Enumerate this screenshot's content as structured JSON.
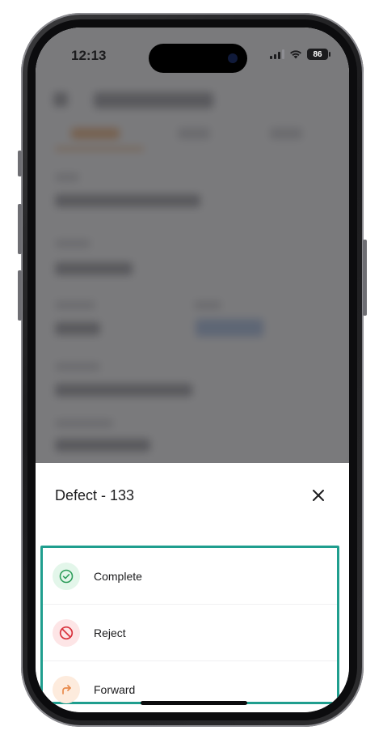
{
  "status_bar": {
    "time": "12:13",
    "battery": "86",
    "icons": [
      "cellular-signal-icon",
      "wifi-icon",
      "battery-icon"
    ]
  },
  "sheet": {
    "title": "Defect - 133",
    "close_icon": "close-icon",
    "actions": [
      {
        "label": "Complete",
        "icon": "check-circle-icon",
        "icon_color": "#2e9d5b",
        "icon_bg": "#e3f6ea"
      },
      {
        "label": "Reject",
        "icon": "block-icon",
        "icon_color": "#d8313b",
        "icon_bg": "#fde5e6"
      },
      {
        "label": "Forward",
        "icon": "forward-arrow-icon",
        "icon_color": "#e8894a",
        "icon_bg": "#fdebdd"
      }
    ]
  },
  "colors": {
    "highlight_border": "#1f9e8e",
    "overlay": "#46464a"
  }
}
